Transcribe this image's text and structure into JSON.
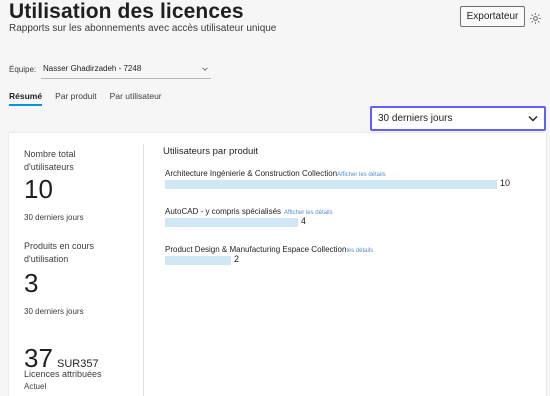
{
  "header": {
    "title": "Utilisation des licences",
    "subtitle": "Rapports sur les abonnements avec accès utilisateur unique",
    "export_label": "Exportateur"
  },
  "team": {
    "label": "Équipe:",
    "value": "Nasser Ghadirzadeh - 7248"
  },
  "tabs": [
    {
      "label": "Résumé",
      "active": true
    },
    {
      "label": "Par produit",
      "active": false
    },
    {
      "label": "Par utilisateur",
      "active": false
    }
  ],
  "period": {
    "value": "30 derniers jours"
  },
  "stats": {
    "total_users": {
      "label_line1": "Nombre total",
      "label_line2": "d'utilisateurs",
      "value": "10",
      "period": "30 derniers jours"
    },
    "products_in_use": {
      "label_line1": "Produits en cours",
      "label_line2": "d'utilisation",
      "value": "3",
      "period": "30 derniers jours"
    },
    "assigned_licenses": {
      "value": "37",
      "total": "SUR357",
      "label": "Licences attribuées",
      "status": "Actuel"
    }
  },
  "products_section": {
    "title": "Utilisateurs par produit",
    "items": [
      {
        "name": "Architecture Ingénierie & Construction Collection",
        "link": "Afficher les détails",
        "count": "10",
        "users": 10
      },
      {
        "name": "AutoCAD - y compris spécialisés",
        "link": "Afficher les détails",
        "count": "4",
        "users": 4
      },
      {
        "name": "Product Design & Manufacturing Espace Collection",
        "link": "les détails",
        "count": "2",
        "users": 2
      }
    ]
  },
  "colors": {
    "accent": "#0696d7",
    "bar": "#cfe7f4",
    "focus": "#5f60ff",
    "link": "#4f8fd6"
  }
}
